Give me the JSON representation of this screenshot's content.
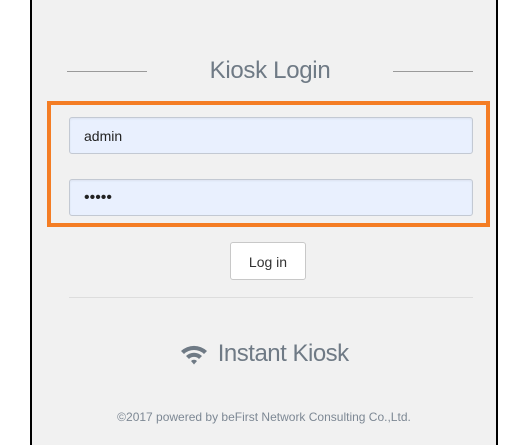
{
  "login_panel": {
    "title": "Kiosk Login",
    "username": {
      "value": "admin",
      "placeholder": ""
    },
    "password": {
      "value": "admin",
      "placeholder": ""
    },
    "login_button_label": "Log in"
  },
  "brand": {
    "icon": "wifi-icon",
    "name": "Instant Kiosk"
  },
  "footer": {
    "copyright": "©2017 powered by beFirst Network Consulting Co.,Ltd."
  },
  "colors": {
    "highlight": "#f47d24",
    "field_background": "#e9f0fe",
    "text_muted": "#6f7a85"
  }
}
